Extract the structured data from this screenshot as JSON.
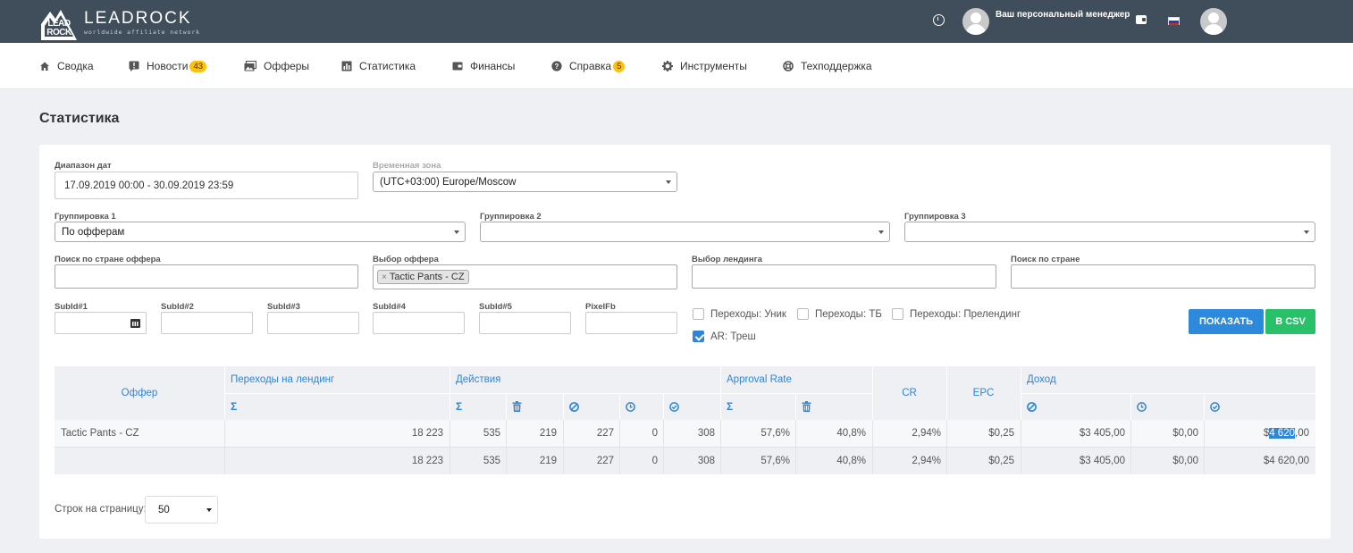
{
  "brand": {
    "name": "LEADROCK",
    "tagline": "worldwide affiliate network",
    "badge_top": "LEAD",
    "badge_bottom": "ROCK"
  },
  "header": {
    "manager_label": "Ваш персональный менеджер"
  },
  "nav": [
    {
      "label": "Сводка",
      "icon": "home-icon"
    },
    {
      "label": "Новости",
      "icon": "alert-icon",
      "badge": "43"
    },
    {
      "label": "Офферы",
      "icon": "images-icon"
    },
    {
      "label": "Статистика",
      "icon": "bar-chart-icon"
    },
    {
      "label": "Финансы",
      "icon": "wallet-icon"
    },
    {
      "label": "Справка",
      "icon": "help-icon",
      "badge": "5"
    },
    {
      "label": "Инструменты",
      "icon": "gear-icon"
    },
    {
      "label": "Техподдержка",
      "icon": "lifebuoy-icon"
    }
  ],
  "page_title": "Статистика",
  "filters": {
    "date_range": {
      "label": "Диапазон дат",
      "value": "17.09.2019 00:00 - 30.09.2019 23:59"
    },
    "timezone": {
      "label": "Временная зона",
      "value": "(UTC+03:00) Europe/Moscow"
    },
    "group1": {
      "label": "Группировка 1",
      "value": "По офферам"
    },
    "group2": {
      "label": "Группировка 2",
      "value": ""
    },
    "group3": {
      "label": "Группировка 3",
      "value": ""
    },
    "offer_country": {
      "label": "Поиск по стране оффера",
      "value": ""
    },
    "offer_select": {
      "label": "Выбор оффера",
      "tag": "Tactic Pants - CZ",
      "tag_remove": "×"
    },
    "landing_select": {
      "label": "Выбор лендинга",
      "value": ""
    },
    "country_search": {
      "label": "Поиск по стране",
      "value": ""
    },
    "subids": [
      "SubId#1",
      "SubId#2",
      "SubId#3",
      "SubId#4",
      "SubId#5",
      "PixelFb"
    ],
    "checkboxes": [
      {
        "label": "Переходы: Уник",
        "checked": false
      },
      {
        "label": "Переходы: ТБ",
        "checked": false
      },
      {
        "label": "Переходы: Прелендинг",
        "checked": false
      },
      {
        "label": "AR: Треш",
        "checked": true
      }
    ],
    "show_button": "ПОКАЗАТЬ",
    "csv_button": "В CSV"
  },
  "table": {
    "groups": {
      "offer": "Оффер",
      "landing_clicks": "Переходы на лендинг",
      "actions": "Действия",
      "approval_rate": "Approval Rate",
      "cr": "CR",
      "epc": "EPC",
      "income": "Доход"
    },
    "sigma": "Σ",
    "rows": [
      {
        "offer": "Tactic Pants - CZ",
        "clicks": "18 223",
        "a_sum": "535",
        "a_trash": "219",
        "a_rej": "227",
        "a_hold": "0",
        "a_ok": "308",
        "ar_sum": "57,6%",
        "ar_trash": "40,8%",
        "cr": "2,94%",
        "epc": "$0,25",
        "inc_rej": "$3 405,00",
        "inc_hold": "$0,00",
        "inc_ok_pre": "$",
        "inc_ok_hl": "4 620",
        "inc_ok_post": ",00"
      }
    ],
    "total": {
      "clicks": "18 223",
      "a_sum": "535",
      "a_trash": "219",
      "a_rej": "227",
      "a_hold": "0",
      "a_ok": "308",
      "ar_sum": "57,6%",
      "ar_trash": "40,8%",
      "cr": "2,94%",
      "epc": "$0,25",
      "inc_rej": "$3 405,00",
      "inc_hold": "$0,00",
      "inc_ok": "$4 620,00"
    }
  },
  "pagination": {
    "label": "Строк на страницу:",
    "value": "50"
  }
}
